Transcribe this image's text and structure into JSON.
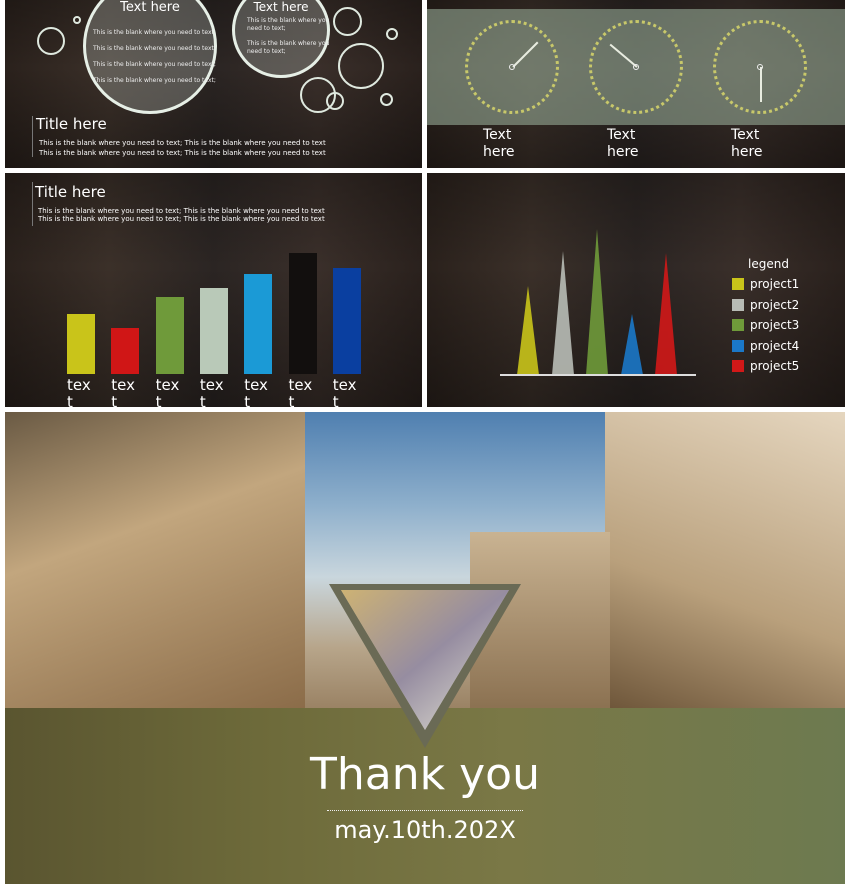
{
  "slide1": {
    "circle_left": {
      "heading": "Text here",
      "lines": [
        "This is the blank where you need to text;",
        "This is the blank where you need to text;",
        "This is the blank where you need to text;",
        "This is the blank where you need to text;"
      ]
    },
    "circle_right": {
      "heading": "Text here",
      "lines": [
        "This is the blank where you need to text;",
        "This is the blank where you need to text;"
      ]
    },
    "title": "Title here",
    "body": [
      "This is the blank where you need to text; This is the blank where you need to text",
      "This is the blank where you need to text; This is the blank where you need to text"
    ]
  },
  "slide2": {
    "clocks": [
      {
        "label": "Text here",
        "hand_angle_deg": 45
      },
      {
        "label": "Text here",
        "hand_angle_deg": 310
      },
      {
        "label": "Text here",
        "hand_angle_deg": 180
      }
    ],
    "ring_color": "#c8c86a"
  },
  "slide3": {
    "title": "Title here",
    "body": [
      "This is the blank where you need to text; This is the blank where you need to text",
      "This is the blank where you need to text; This is the blank where you need to text"
    ],
    "bars": [
      {
        "label": "tex t",
        "value": 50,
        "color": "#c9c41a"
      },
      {
        "label": "tex t",
        "value": 38,
        "color": "#d01616"
      },
      {
        "label": "tex t",
        "value": 64,
        "color": "#6f9a3a"
      },
      {
        "label": "tex t",
        "value": 71,
        "color": "#b9c9b8"
      },
      {
        "label": "tex t",
        "value": 83,
        "color": "#1b9ad6"
      },
      {
        "label": "tex t",
        "value": 100,
        "color": "#120f0e"
      },
      {
        "label": "tex t",
        "value": 88,
        "color": "#0a3fa0"
      }
    ]
  },
  "slide4": {
    "legend_title": "legend",
    "series": [
      {
        "name": "project1",
        "value": 61,
        "color": "#c9c41a"
      },
      {
        "name": "project2",
        "value": 85,
        "color": "#b8bcb6"
      },
      {
        "name": "project3",
        "value": 100,
        "color": "#6f9a3a"
      },
      {
        "name": "project4",
        "value": 42,
        "color": "#1b78c8"
      },
      {
        "name": "project5",
        "value": 84,
        "color": "#d21818"
      }
    ]
  },
  "slide5": {
    "title": "Thank you",
    "date": "may.10th.202X",
    "band_color": "#6d6a3a"
  }
}
